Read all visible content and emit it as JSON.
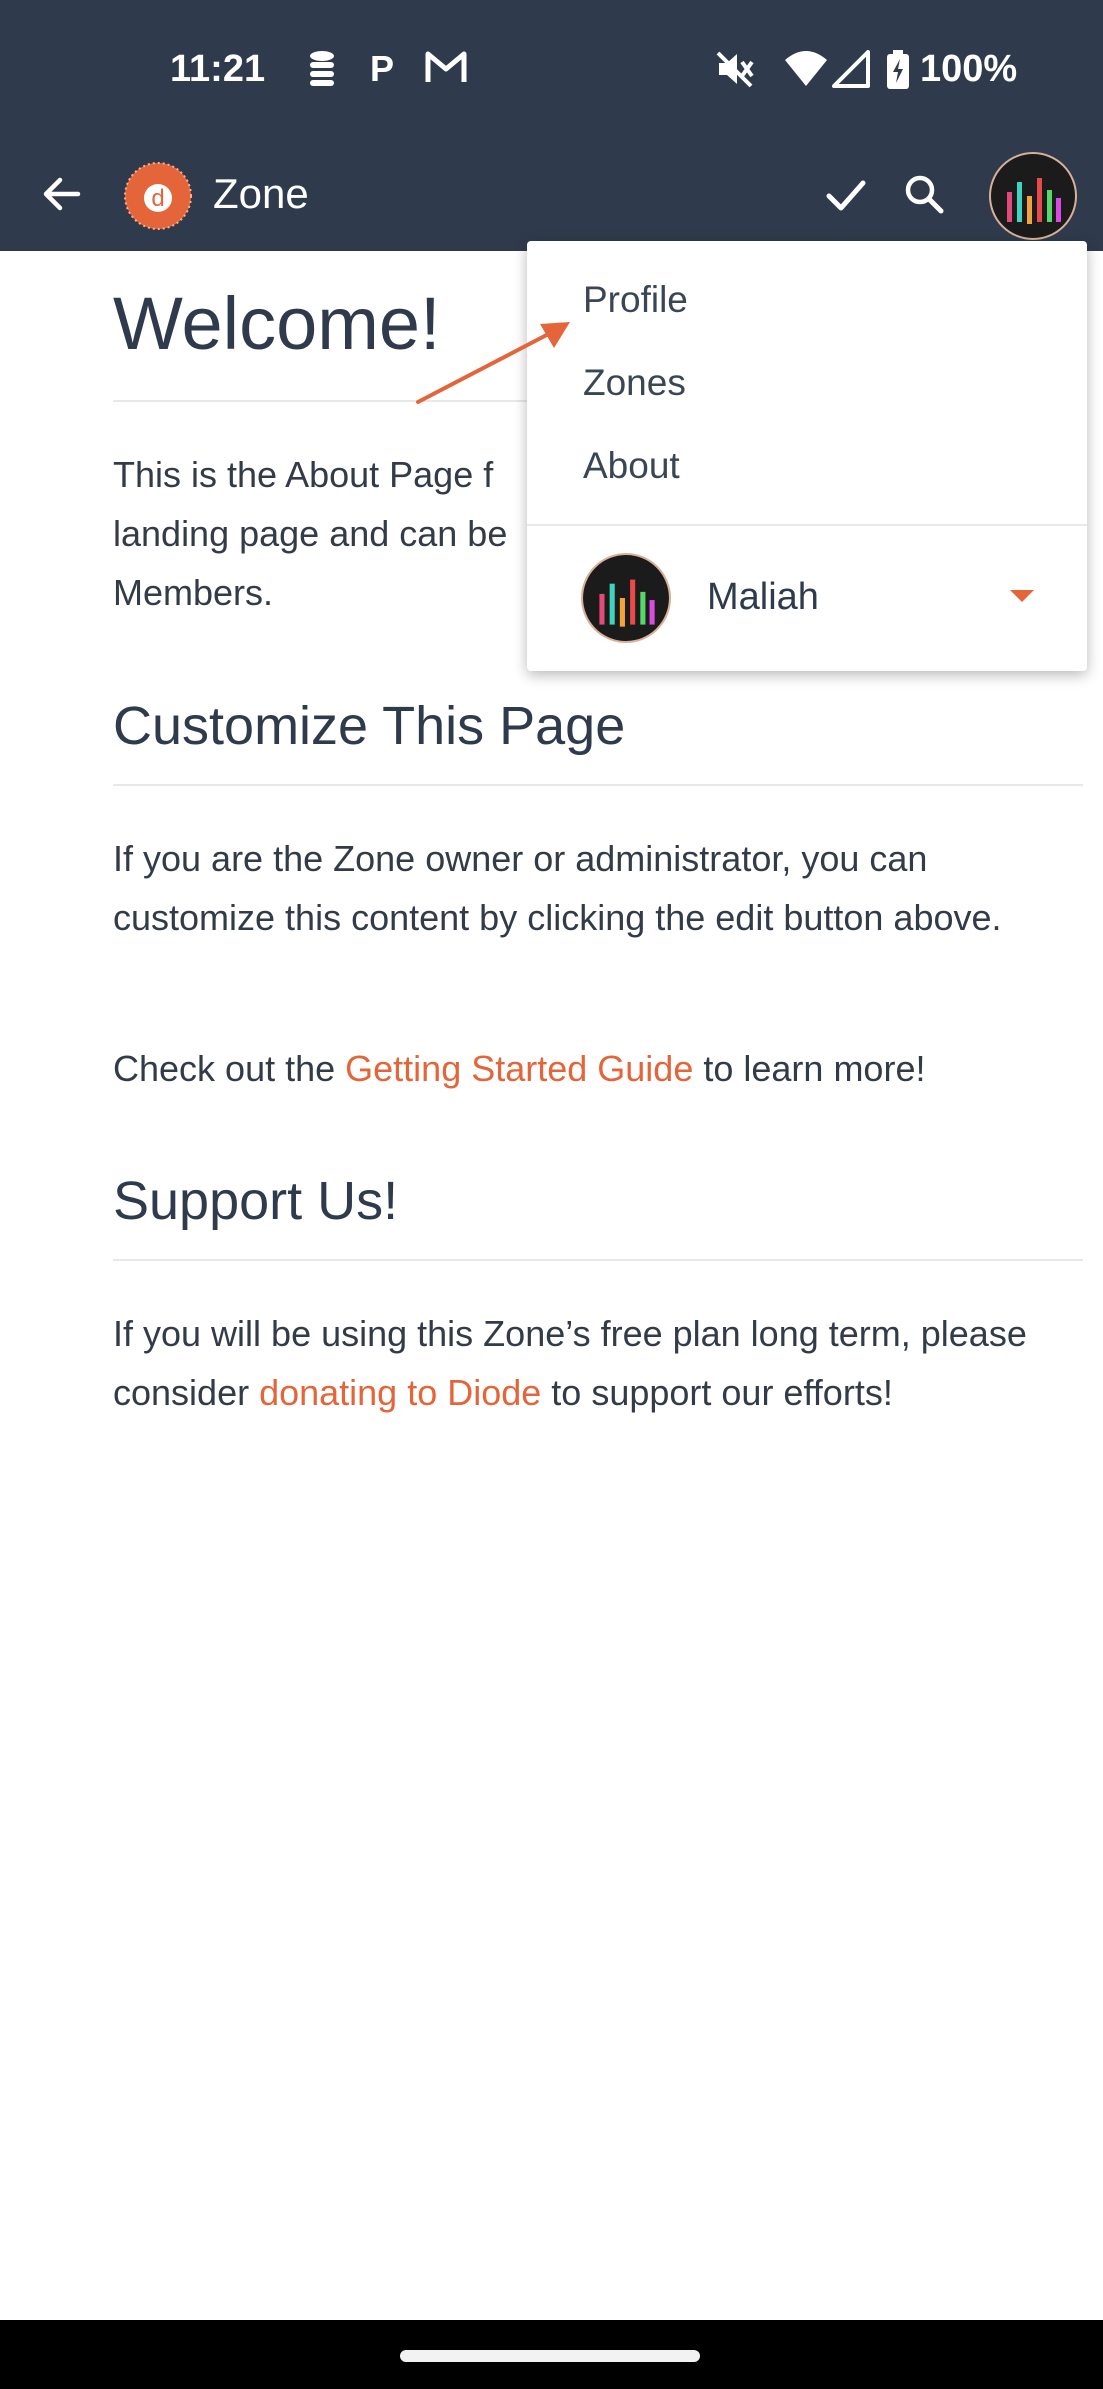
{
  "status_bar": {
    "time": "11:21",
    "battery": "100%",
    "icons": [
      "database-icon",
      "parking-icon",
      "gmail-icon",
      "mute-icon",
      "wifi-icon",
      "signal-icon",
      "battery-icon"
    ]
  },
  "app_bar": {
    "title": "Zone",
    "icons": [
      "back-arrow-icon",
      "diode-logo-icon",
      "check-icon",
      "search-icon",
      "avatar"
    ]
  },
  "page": {
    "title": "Welcome!",
    "intro": "This is the About Page f… landing page and can be… Members.",
    "intro_lines": [
      "This is the About Page f",
      "landing page and can be",
      "Members."
    ],
    "customize_heading": "Customize This Page",
    "customize_text": "If you are the Zone owner or administrator, you can customize this content by clicking the edit button above.",
    "guide_prefix": "Check out the ",
    "guide_link": "Getting Started Guide",
    "guide_suffix": " to learn more!",
    "support_heading": "Support Us!",
    "support_prefix": "If you will be using this Zone’s free plan long term, please consider ",
    "support_link": "donating to Diode",
    "support_suffix": " to support our efforts!"
  },
  "menu": {
    "items": [
      {
        "label": "Profile"
      },
      {
        "label": "Zones"
      },
      {
        "label": "About"
      }
    ],
    "user_name": "Maliah"
  },
  "colors": {
    "header_bg": "#2f3b4c",
    "accent": "#e4653a",
    "text": "#323b47"
  }
}
